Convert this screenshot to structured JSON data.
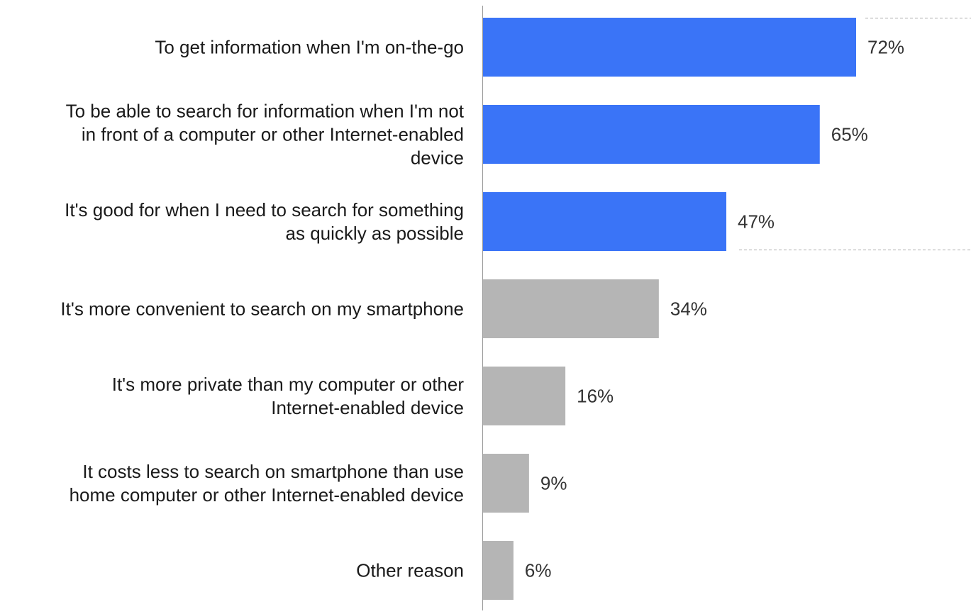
{
  "chart_data": {
    "type": "bar",
    "orientation": "horizontal",
    "title": "",
    "xlabel": "",
    "ylabel": "",
    "xlim": [
      0,
      100
    ],
    "grid": false,
    "legend": "none",
    "categories": [
      [
        "To get information when I'm on-the-go"
      ],
      [
        "To be able to search for information when I'm not",
        "in front of a computer or other Internet-enabled",
        "device"
      ],
      [
        "It's good for when I need to search for something",
        "as quickly as possible"
      ],
      [
        "It's more convenient to search on my smartphone"
      ],
      [
        "It's more private than my computer or other",
        "Internet-enabled device"
      ],
      [
        "It costs less to search on smartphone than use",
        "home computer or other Internet-enabled device"
      ],
      [
        "Other reason"
      ]
    ],
    "values": [
      72,
      65,
      47,
      34,
      16,
      9,
      6
    ],
    "value_labels": [
      "72%",
      "65%",
      "47%",
      "34%",
      "16%",
      "9%",
      "6%"
    ],
    "highlighted": [
      true,
      true,
      true,
      false,
      false,
      false,
      false
    ],
    "colors": {
      "highlight": "#3a74f7",
      "default": "#b5b5b5",
      "axis": "#999999",
      "bracket": "#aaaaaa"
    }
  }
}
